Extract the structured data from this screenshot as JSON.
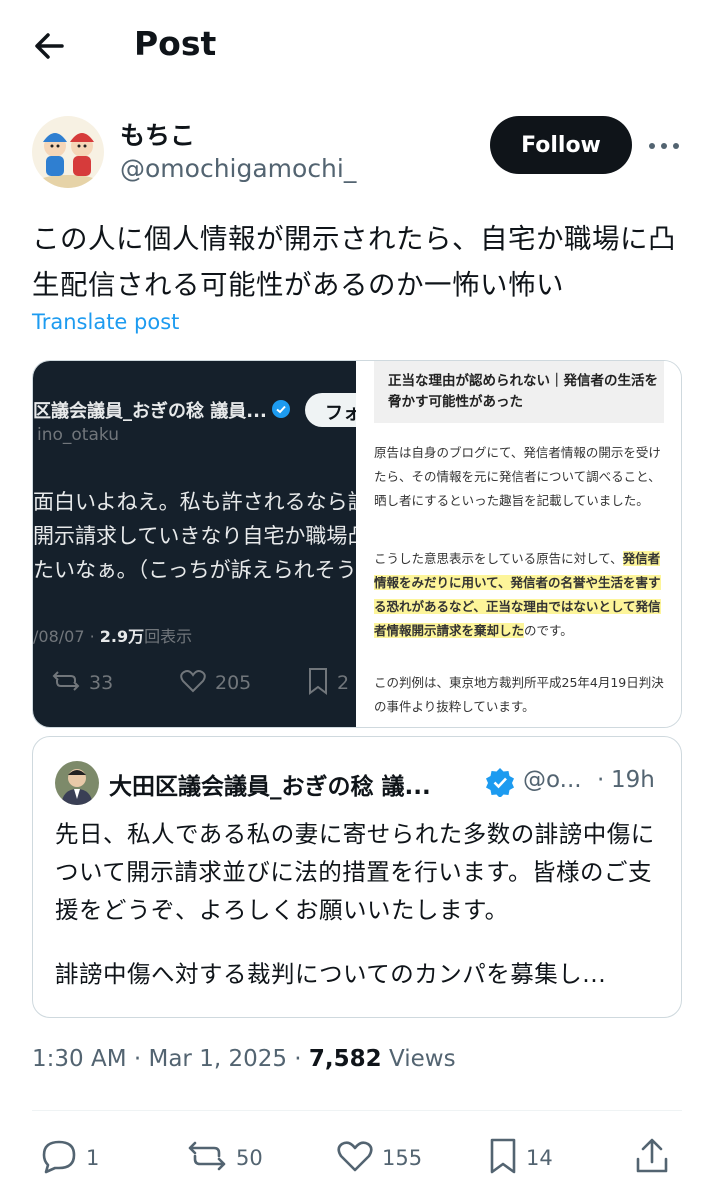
{
  "header": {
    "title": "Post"
  },
  "author": {
    "name": "もちこ",
    "handle": "@omochigamochi_",
    "follow_label": "Follow"
  },
  "post": {
    "text": "この人に個人情報が開示されたら、自宅か職場に凸生配信される可能性があるのか一怖い怖い",
    "translate_label": "Translate post",
    "time": "1:30 AM",
    "date": "Mar 1, 2025",
    "views_count": "7,582",
    "views_label": "Views"
  },
  "media_left": {
    "name": "区議会議員_おぎの稔 議員...",
    "follow_label": "フォ",
    "handle": "ino_otaku",
    "lines": [
      "面白いよねえ。私も許されるなら訴",
      "開示請求していきなり自宅か職場凸",
      "たいなぁ。（こっちが訴えられそう"
    ],
    "date": "/08/07",
    "views_count": "2.9万",
    "views_label": "回表示",
    "retweets": "33",
    "likes": "205",
    "bookmarks": "2"
  },
  "media_right": {
    "header": "正当な理由が認められない｜発信者の生活を脅かす可能性があった",
    "para1": "原告は自身のブログにて、発信者情報の開示を受けたら、その情報を元に発信者について調べること、晒し者にするといった趣旨を記載していました。",
    "para2_pre": "こうした意思表示をしている原告に対して、",
    "para2_hl": "発信者情報をみだりに用いて、発信者の名誉や生活を害する恐れがあるなど、正当な理由ではないとして発信者情報開示請求を棄却した",
    "para2_post": "のです。",
    "para3": "この判例は、東京地方裁判所平成25年4月19日判決の事件より抜粋しています。"
  },
  "quote": {
    "name": "大田区議会議員_おぎの稔 議...",
    "handle": "@o...",
    "time": "19h",
    "text": "先日、私人である私の妻に寄せられた多数の誹謗中傷について開示請求並びに法的措置を行います。皆様のご支援をどうぞ、よろしくお願いいたします。",
    "more": "誹謗中傷へ対する裁判についてのカンパを募集し..."
  },
  "actions": {
    "replies": "1",
    "reposts": "50",
    "likes": "155",
    "bookmarks": "14"
  },
  "icons": [
    "back-arrow-icon",
    "more-icon",
    "verified-icon",
    "reply-icon",
    "repost-icon",
    "like-icon",
    "bookmark-icon",
    "share-icon"
  ],
  "colors": {
    "accent": "#1d9bf0",
    "text": "#0f1419",
    "muted": "#536471",
    "dark_card": "#15202b",
    "highlight": "#fdf59a"
  }
}
